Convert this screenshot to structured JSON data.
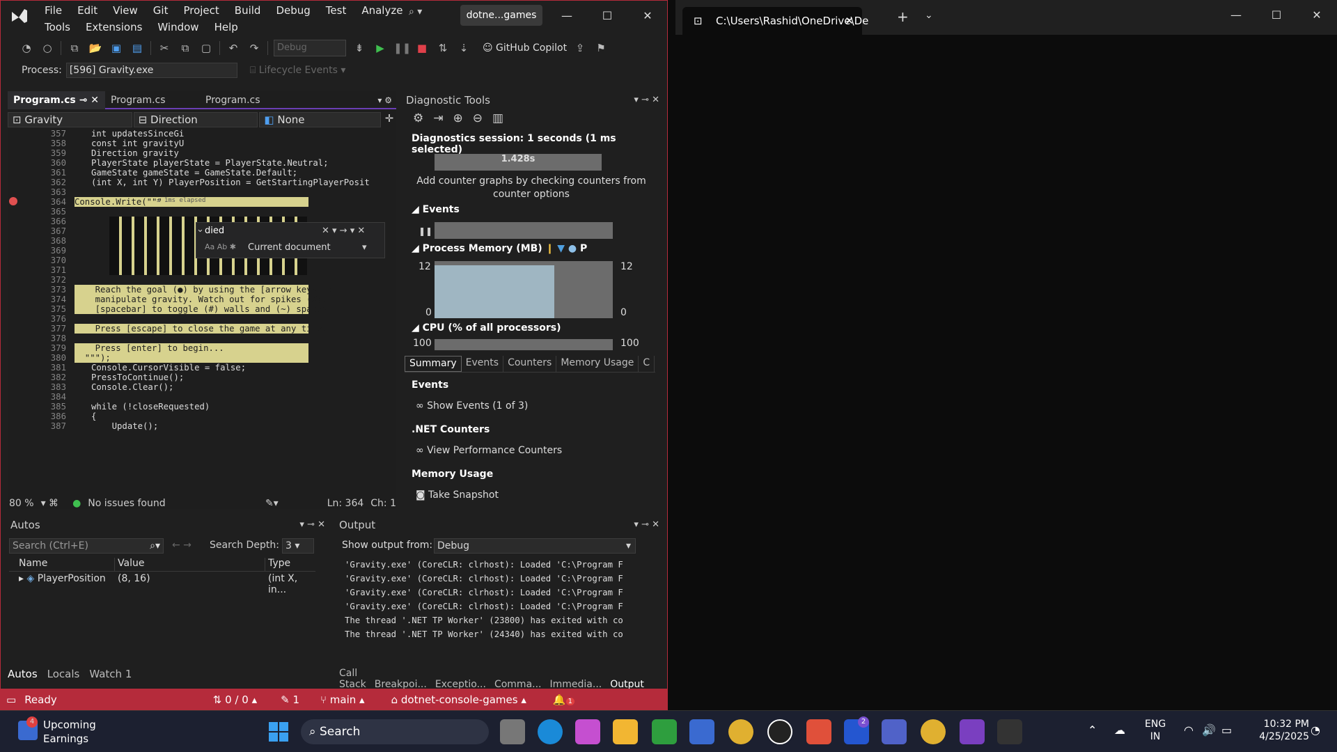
{
  "vs": {
    "menu_row1": [
      "File",
      "Edit",
      "View",
      "Git",
      "Project",
      "Build",
      "Debug",
      "Test",
      "Analyze"
    ],
    "menu_row2": [
      "Tools",
      "Extensions",
      "Window",
      "Help"
    ],
    "solution_name": "dotne...games",
    "config": "Debug",
    "copilot": "GitHub Copilot",
    "process_label": "Process:",
    "process_value": "[596] Gravity.exe",
    "lifecycle": "Lifecycle Events",
    "tabs": [
      "Program.cs",
      "Program.cs",
      "Program.cs"
    ],
    "nav": {
      "class": "Gravity",
      "member": "Direction",
      "third": "None"
    },
    "find": {
      "query": "died",
      "scope": "Current document",
      "opt1": "Aa",
      "opt2": "Ab"
    },
    "code_lines": [
      {
        "n": "357",
        "t": "int updatesSinceGi"
      },
      {
        "n": "358",
        "t": "const int gravityU"
      },
      {
        "n": "359",
        "t": "Direction gravity "
      },
      {
        "n": "360",
        "t": "PlayerState playerState = PlayerState.Neutral;"
      },
      {
        "n": "361",
        "t": "GameState gameState = GameState.Default;"
      },
      {
        "n": "362",
        "t": "(int X, int Y) PlayerPosition = GetStartingPlayerPosit"
      },
      {
        "n": "363",
        "t": ""
      },
      {
        "n": "364",
        "t": "Console.Write(\"\"\""
      },
      {
        "n": "365",
        "t": ""
      },
      {
        "n": "366",
        "t": ""
      },
      {
        "n": "367",
        "t": ""
      },
      {
        "n": "368",
        "t": ""
      },
      {
        "n": "369",
        "t": ""
      },
      {
        "n": "370",
        "t": ""
      },
      {
        "n": "371",
        "t": ""
      },
      {
        "n": "372",
        "t": ""
      },
      {
        "n": "373",
        "t": "    Reach the goal (●) by using the [arrow keys] o"
      },
      {
        "n": "374",
        "t": "    manipulate gravity. Watch out for spikes (X)."
      },
      {
        "n": "375",
        "t": "    [spacebar] to toggle (#) walls and (~) spaces."
      },
      {
        "n": "376",
        "t": ""
      },
      {
        "n": "377",
        "t": "    Press [escape] to close the game at any time."
      },
      {
        "n": "378",
        "t": ""
      },
      {
        "n": "379",
        "t": "    Press [enter] to begin..."
      },
      {
        "n": "380",
        "t": "  \"\"\");"
      },
      {
        "n": "381",
        "t": "Console.CursorVisible = false;"
      },
      {
        "n": "382",
        "t": "PressToContinue();"
      },
      {
        "n": "383",
        "t": "Console.Clear();"
      },
      {
        "n": "384",
        "t": ""
      },
      {
        "n": "385",
        "t": "while (!closeRequested)"
      },
      {
        "n": "386",
        "t": "{"
      },
      {
        "n": "387",
        "t": "    Update();"
      }
    ],
    "elapsed": "≤ 1ms elapsed",
    "zoom": "80 %",
    "issues": "No issues found",
    "ln": "Ln: 364",
    "ch": "Ch: 1",
    "diag": {
      "title": "Diagnostic Tools",
      "session": "Diagnostics session: 1 seconds (1 ms selected)",
      "timeline": "1.428s",
      "counter_hint": "Add counter graphs by checking counters from counter options",
      "events": "Events",
      "memory": "Process Memory (MB)",
      "mem_max": "12",
      "mem_min": "0",
      "mem_legend": "P",
      "cpu": "CPU (% of all processors)",
      "cpu_max": "100",
      "tabs": [
        "Summary",
        "Events",
        "Counters",
        "Memory Usage",
        "C"
      ],
      "sec_events": "Events",
      "show_events": "Show Events (1 of 3)",
      "sec_net": ".NET Counters",
      "view_perf": "View Performance Counters",
      "sec_mem": "Memory Usage",
      "snapshot": "Take Snapshot"
    },
    "autos": {
      "title": "Autos",
      "search": "Search (Ctrl+E)",
      "depth_label": "Search Depth:",
      "depth": "3",
      "cols": [
        "Name",
        "Value",
        "Type"
      ],
      "row": {
        "name": "PlayerPosition",
        "value": "(8, 16)",
        "type": "(int X, in..."
      },
      "tabs": [
        "Autos",
        "Locals",
        "Watch 1"
      ]
    },
    "output": {
      "title": "Output",
      "show_from": "Show output from:",
      "source": "Debug",
      "lines": [
        "'Gravity.exe' (CoreCLR: clrhost): Loaded 'C:\\Program F",
        "'Gravity.exe' (CoreCLR: clrhost): Loaded 'C:\\Program F",
        "'Gravity.exe' (CoreCLR: clrhost): Loaded 'C:\\Program F",
        "'Gravity.exe' (CoreCLR: clrhost): Loaded 'C:\\Program F",
        "The thread '.NET TP Worker' (23800) has exited with co",
        "The thread '.NET TP Worker' (24340) has exited with co"
      ],
      "tabs": [
        "Call Stack",
        "Breakpoi...",
        "Exceptio...",
        "Comma...",
        "Immedia...",
        "Output"
      ]
    },
    "status": {
      "ready": "Ready",
      "changes": "0 / 0",
      "pencil": "1",
      "branch": "main",
      "repo": "dotnet-console-games",
      "notif": "1"
    }
  },
  "terminal": {
    "tab_title": "C:\\Users\\Rashid\\OneDrive\\De"
  },
  "taskbar": {
    "weather_badge": "4",
    "weather_title": "Upcoming",
    "weather_sub": "Earnings",
    "search": "Search",
    "lang1": "ENG",
    "lang2": "IN",
    "time": "10:32 PM",
    "date": "4/25/2025",
    "app_badge": "2"
  },
  "colors": {
    "accent": "#b52b3b",
    "vs_purple": "#6b3fb5",
    "hl": "#d7d28e"
  }
}
